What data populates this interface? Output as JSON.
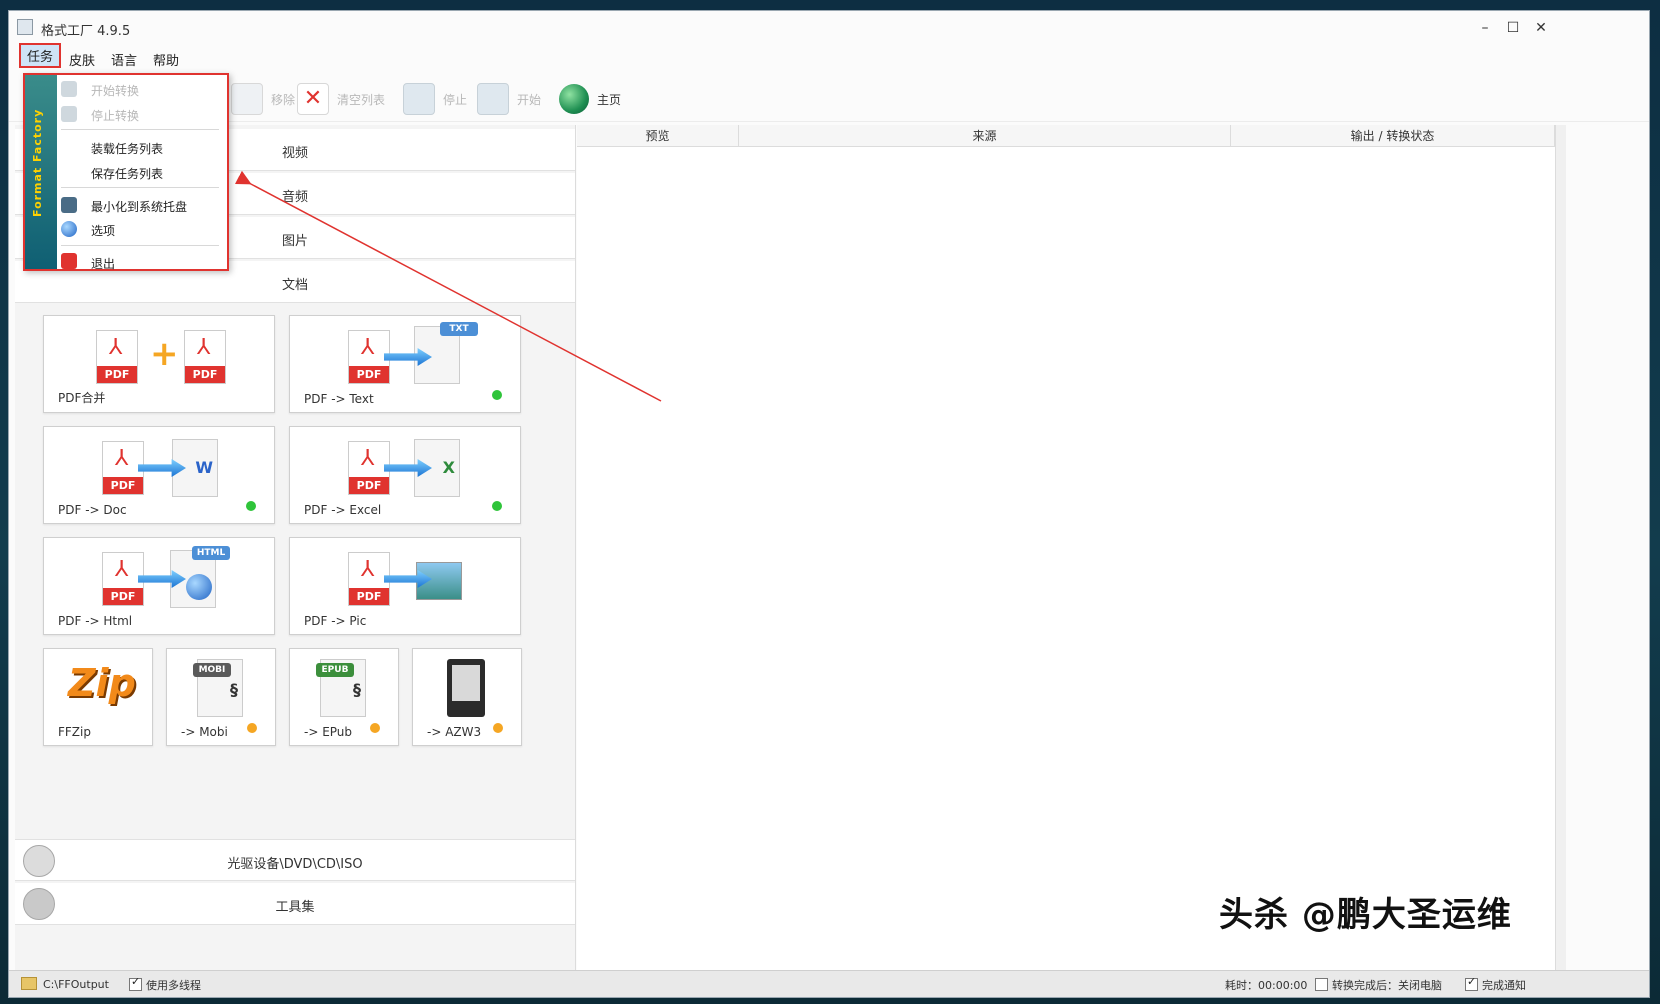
{
  "window": {
    "title": "格式工厂 4.9.5"
  },
  "menubar": {
    "items": [
      "任务",
      "皮肤",
      "语言",
      "帮助"
    ]
  },
  "toolbar": {
    "remove": "移除",
    "clear_list": "清空列表",
    "stop": "停止",
    "start": "开始",
    "home": "主页"
  },
  "categories": {
    "video": "视频",
    "audio": "音频",
    "picture": "图片",
    "document": "文档",
    "rom": "光驱设备\\DVD\\CD\\ISO",
    "tools": "工具集"
  },
  "tiles": [
    {
      "label": "PDF合并",
      "dot": ""
    },
    {
      "label": "PDF -> Text",
      "dot": "green"
    },
    {
      "label": "PDF -> Doc",
      "dot": "green"
    },
    {
      "label": "PDF -> Excel",
      "dot": "green"
    },
    {
      "label": "PDF -> Html",
      "dot": ""
    },
    {
      "label": "PDF -> Pic",
      "dot": ""
    },
    {
      "label": "FFZip",
      "dot": ""
    },
    {
      "label": "-> Mobi",
      "dot": "orange"
    },
    {
      "label": "-> EPub",
      "dot": "orange"
    },
    {
      "label": "-> AZW3",
      "dot": "orange"
    }
  ],
  "tile_icons": {
    "pdf": "PDF",
    "plus": "+",
    "txt": "TXT",
    "word": "W",
    "excel": "X",
    "html": "HTML",
    "zip": "Zip",
    "mobi": "MOBI",
    "epub": "EPUB"
  },
  "task_menu": {
    "brand": "Format Factory",
    "items": [
      {
        "label": "开始转换",
        "disabled": true
      },
      {
        "label": "停止转换",
        "disabled": true
      },
      {
        "label": "装载任务列表",
        "disabled": false
      },
      {
        "label": "保存任务列表",
        "disabled": false
      },
      {
        "label": "最小化到系统托盘",
        "disabled": false
      },
      {
        "label": "选项",
        "disabled": false
      },
      {
        "label": "退出",
        "disabled": false
      }
    ]
  },
  "task_table": {
    "columns": [
      "预览",
      "来源",
      "输出 / 转换状态"
    ]
  },
  "statusbar": {
    "output_path": "C:\\FFOutput",
    "multithread": "使用多线程",
    "elapsed": "耗时：00:00:00",
    "after_done": "转换完成后：关闭电脑",
    "notify": "完成通知"
  },
  "watermark": "头杀 @鹏大圣运维",
  "colors": {
    "accent_red": "#e0332f",
    "dot_green": "#2fc43a",
    "dot_orange": "#f5a623",
    "brand_yellow": "#ffd200"
  }
}
